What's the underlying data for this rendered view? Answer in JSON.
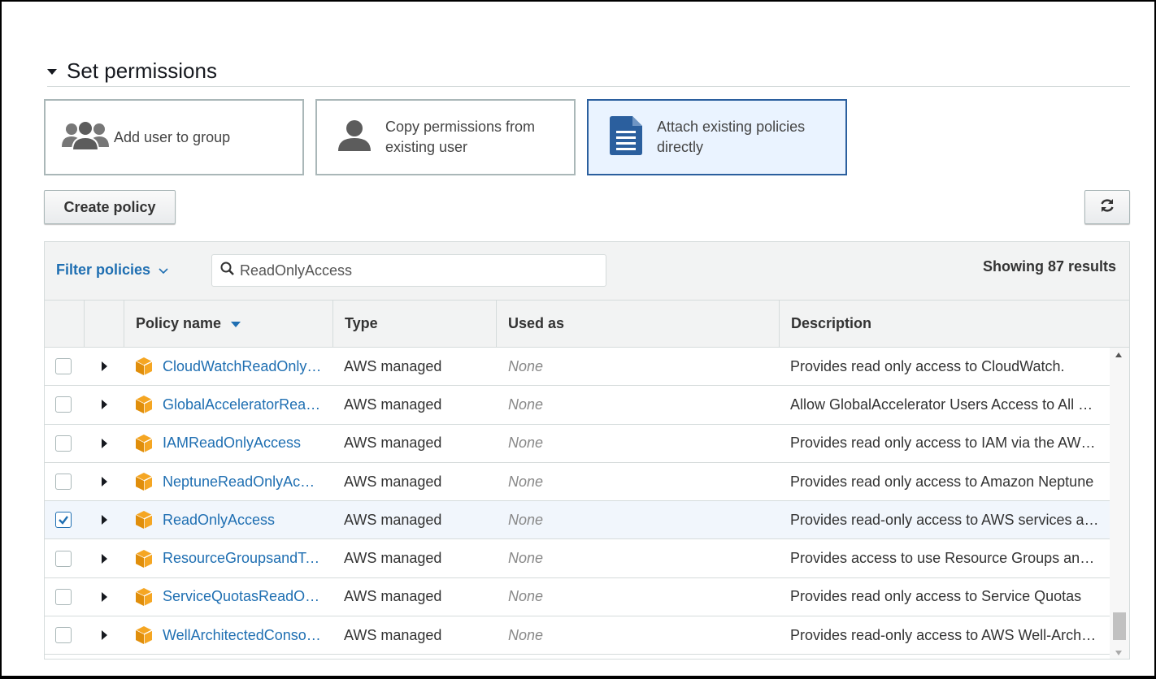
{
  "section": {
    "title": "Set permissions"
  },
  "options": [
    {
      "label": "Add user to group",
      "icon": "group-icon",
      "selected": false
    },
    {
      "label": "Copy permissions from existing user",
      "icon": "user-icon",
      "selected": false
    },
    {
      "label": "Attach existing policies directly",
      "icon": "document-icon",
      "selected": true
    }
  ],
  "toolbar": {
    "create_label": "Create policy",
    "refresh_icon": "refresh-icon"
  },
  "filter": {
    "label": "Filter policies",
    "search_value": "ReadOnlyAccess",
    "results": "Showing 87 results"
  },
  "columns": {
    "policy_name": "Policy name",
    "type": "Type",
    "used_as": "Used as",
    "description": "Description"
  },
  "rows": [
    {
      "name": "CloudWatchReadOnlyAccess",
      "type": "AWS managed",
      "used_as": "None",
      "description": "Provides read only access to CloudWatch.",
      "checked": false
    },
    {
      "name": "GlobalAcceleratorReadOnlyAccess",
      "type": "AWS managed",
      "used_as": "None",
      "description": "Allow GlobalAccelerator Users Access to All Read APIs",
      "checked": false
    },
    {
      "name": "IAMReadOnlyAccess",
      "type": "AWS managed",
      "used_as": "None",
      "description": "Provides read only access to IAM via the AWS Management Console.",
      "checked": false
    },
    {
      "name": "NeptuneReadOnlyAccess",
      "type": "AWS managed",
      "used_as": "None",
      "description": "Provides read only access to Amazon Neptune",
      "checked": false
    },
    {
      "name": "ReadOnlyAccess",
      "type": "AWS managed",
      "used_as": "None",
      "description": "Provides read-only access to AWS services and resources.",
      "checked": true
    },
    {
      "name": "ResourceGroupsandTagEditorReadOnlyAccess",
      "type": "AWS managed",
      "used_as": "None",
      "description": "Provides access to use Resource Groups and Tag Editor",
      "checked": false
    },
    {
      "name": "ServiceQuotasReadOnlyAccess",
      "type": "AWS managed",
      "used_as": "None",
      "description": "Provides read only access to Service Quotas",
      "checked": false
    },
    {
      "name": "WellArchitectedConsoleReadOnlyAccess",
      "type": "AWS managed",
      "used_as": "None",
      "description": "Provides read-only access to AWS Well-Architected Tool",
      "checked": false
    }
  ],
  "colors": {
    "link": "#1f6fb2",
    "selected_border": "#2b5f9e",
    "policy_icon": "#f5a623"
  }
}
